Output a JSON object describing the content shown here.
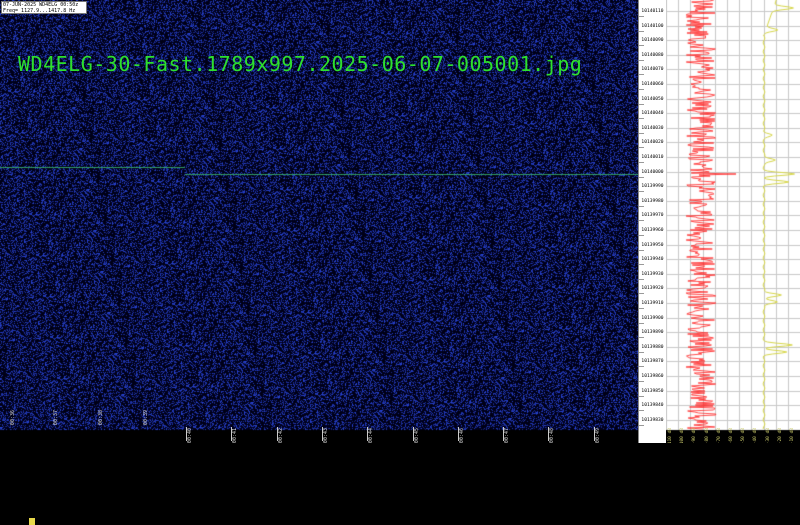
{
  "header": {
    "line1": "07-JUN-2025  WD4ELG  00:50z",
    "line2": "Freq= 1127.9...1417.8 Hz"
  },
  "time_axis": {
    "upper_labels": [
      "00:36",
      "00:37",
      "00:38",
      "00:39"
    ],
    "lower_labels": [
      "00:40",
      "00:41",
      "00:42",
      "00:43",
      "00:44",
      "00:45",
      "00:46",
      "00:47",
      "00:48",
      "00:49"
    ]
  },
  "freq_axis": {
    "labels": [
      "10140110",
      "10140100",
      "10140090",
      "10140080",
      "10140070",
      "10140060",
      "10140050",
      "10140040",
      "10140030",
      "10140020",
      "10140010",
      "10140000",
      "10139990",
      "10139980",
      "10139970",
      "10139960",
      "10139950",
      "10139940",
      "10139930",
      "10139920",
      "10139910",
      "10139900",
      "10139890",
      "10139880",
      "10139870",
      "10139860",
      "10139850",
      "10139840",
      "10139830"
    ]
  },
  "spectrum_scale": {
    "labels": [
      "-110 dB",
      "-100 dB",
      "-90 dB",
      "-80 dB",
      "-70 dB",
      "-60 dB",
      "-50 dB",
      "-40 dB",
      "-30 dB",
      "-20 dB",
      "-10 dB"
    ]
  },
  "colors": {
    "waterfall_bg": "#00001a",
    "noise": "#1e2fa8",
    "signal": "#3cc06a",
    "red_trace": "#ff2020",
    "yellow_trace": "#d7d74a",
    "grid": "#c8c8c8",
    "filename": "#2ee02e"
  },
  "footer": {
    "filename": "WD4ELG-30-Fast.1789x997.2025-06-07-005001.jpg"
  }
}
